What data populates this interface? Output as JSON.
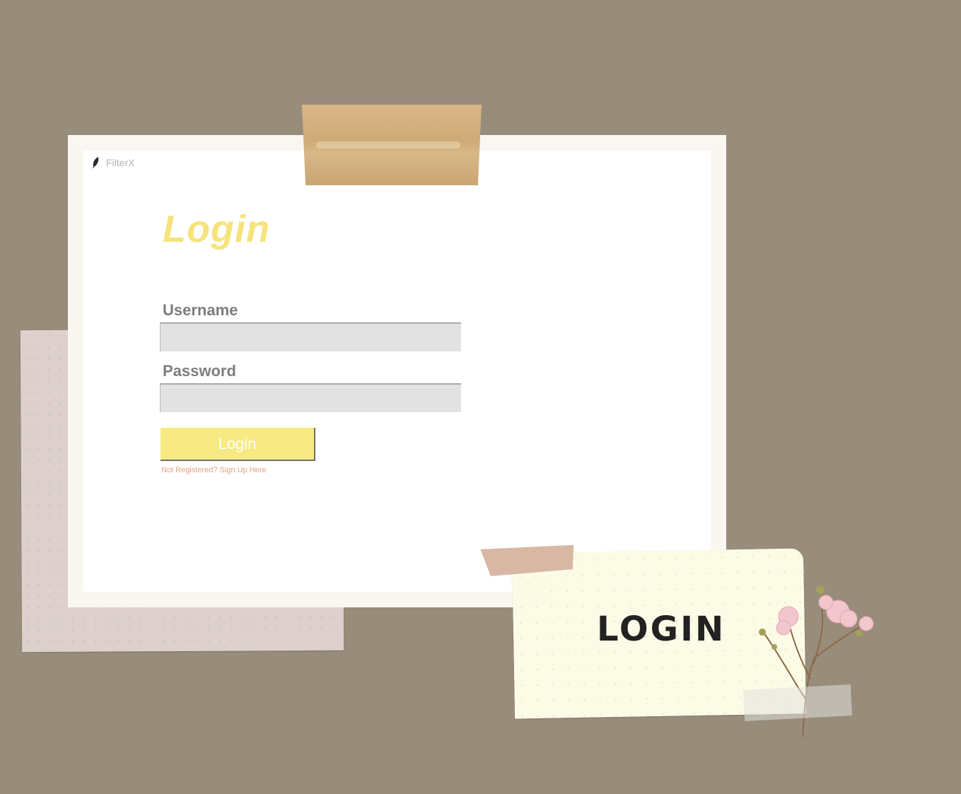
{
  "window": {
    "app_title": "FilterX",
    "app_icon": "feather-icon"
  },
  "form": {
    "heading": "Login",
    "username_label": "Username",
    "username_value": "",
    "password_label": "Password",
    "password_value": "",
    "login_button": "Login",
    "signup_link": "Not Registered? Sign Up Here"
  },
  "note": {
    "text": "LOGIN"
  },
  "colors": {
    "background": "#988c7a",
    "accent_yellow": "#f6e37c",
    "link_orange": "#e3a27a",
    "input_gray": "#e2e2e2"
  }
}
